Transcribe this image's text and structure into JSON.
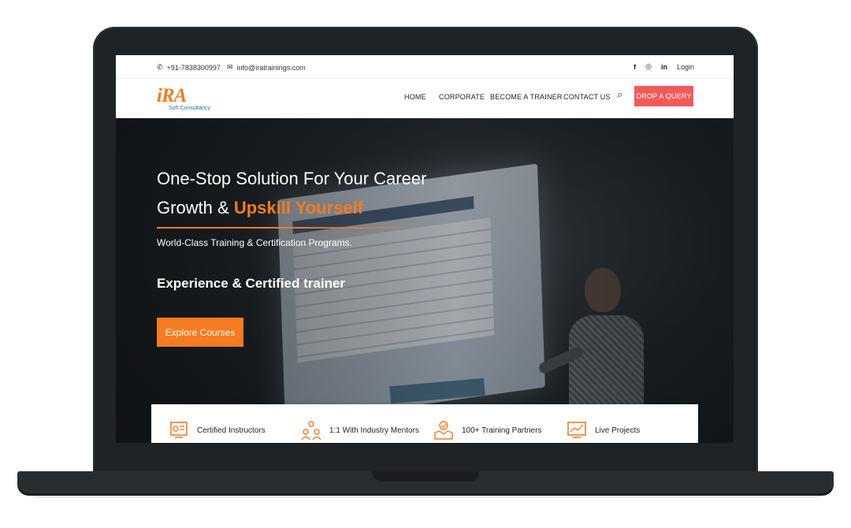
{
  "topbar": {
    "phone": "+91-7838300997",
    "email": "info@iratrainings.com",
    "social": [
      "f",
      "◎",
      "in"
    ],
    "login": "Login"
  },
  "header": {
    "logo_mark": "iRA",
    "logo_sub": "Soft Consultancy",
    "nav": [
      "HOME",
      "CORPORATE",
      "BECOME A TRAINER",
      "CONTACT US"
    ],
    "cta": "DROP A QUERY"
  },
  "hero": {
    "title_line1": "One-Stop Solution For Your Career",
    "title_line2_prefix": "Growth & ",
    "title_highlight": "Upskill Yourself",
    "subtitle": "World-Class Training & Certification Programs.",
    "experience": "Experience & Certified trainer",
    "button": "Explore Courses"
  },
  "features": [
    {
      "icon": "certificate-icon",
      "label": "Certified Instructors"
    },
    {
      "icon": "mentors-icon",
      "label": "1:1 With Industry Mentors"
    },
    {
      "icon": "partners-icon",
      "label": "100+ Training Partners"
    },
    {
      "icon": "chart-icon",
      "label": "Live Projects"
    }
  ],
  "colors": {
    "accent": "#f47b20",
    "cta_red": "#f25a5a",
    "logo_blue": "#1f6fb5",
    "laptop": "#1f2326"
  }
}
